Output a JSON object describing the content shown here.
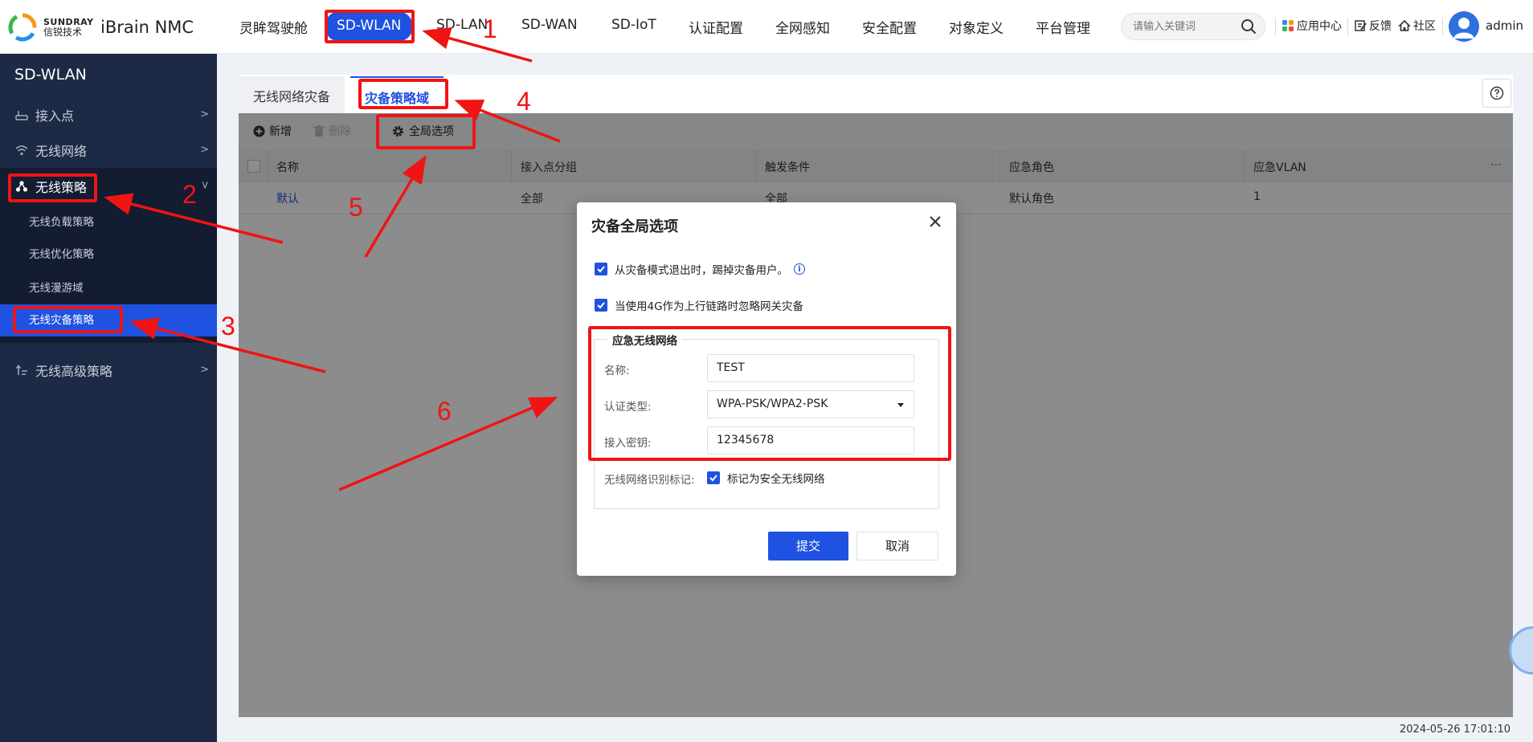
{
  "header": {
    "logo_en": "SUNDRAY",
    "logo_cn": "信锐技术",
    "product": "iBrain NMC",
    "nav": [
      "灵眸驾驶舱",
      "SD-WLAN",
      "SD-LAN",
      "SD-WAN",
      "SD-IoT",
      "认证配置",
      "全网感知",
      "安全配置",
      "对象定义",
      "平台管理"
    ],
    "search_placeholder": "请输入关键词",
    "tools": {
      "app_center": "应用中心",
      "feedback": "反馈",
      "community": "社区"
    },
    "username": "admin"
  },
  "sidebar": {
    "title": "SD-WLAN",
    "items": [
      "接入点",
      "无线网络",
      "无线策略",
      "无线高级策略"
    ],
    "subitems": [
      "无线负载策略",
      "无线优化策略",
      "无线漫游域",
      "无线灾备策略"
    ]
  },
  "tabs": [
    "无线网络灾备",
    "灾备策略域"
  ],
  "toolbar": {
    "add": "新增",
    "delete": "删除",
    "global_options": "全局选项"
  },
  "table": {
    "columns": [
      "名称",
      "接入点分组",
      "触发条件",
      "应急角色",
      "应急VLAN"
    ],
    "rows": [
      {
        "name": "默认",
        "ap_group": "全部",
        "trigger": "全部",
        "role": "默认角色",
        "vlan": "1"
      }
    ]
  },
  "dialog": {
    "title": "灾备全局选项",
    "option1": "从灾备模式退出时，踢掉灾备用户。",
    "option2": "当使用4G作为上行链路时忽略网关灾备",
    "legend": "应急无线网络",
    "name_label": "名称:",
    "name_value": "TEST",
    "auth_label": "认证类型:",
    "auth_value": "WPA-PSK/WPA2-PSK",
    "key_label": "接入密钥:",
    "key_value": "12345678",
    "mark_label": "无线网络识别标记:",
    "mark_check": "标记为安全无线网络",
    "submit": "提交",
    "cancel": "取消"
  },
  "status": {
    "datetime": "2024-05-26 17:01:10"
  },
  "annotations": [
    "1",
    "2",
    "3",
    "4",
    "5",
    "6"
  ],
  "colors": {
    "accent": "#1f52e0",
    "annotation": "#f01414",
    "sidebar": "#1d2a45"
  }
}
